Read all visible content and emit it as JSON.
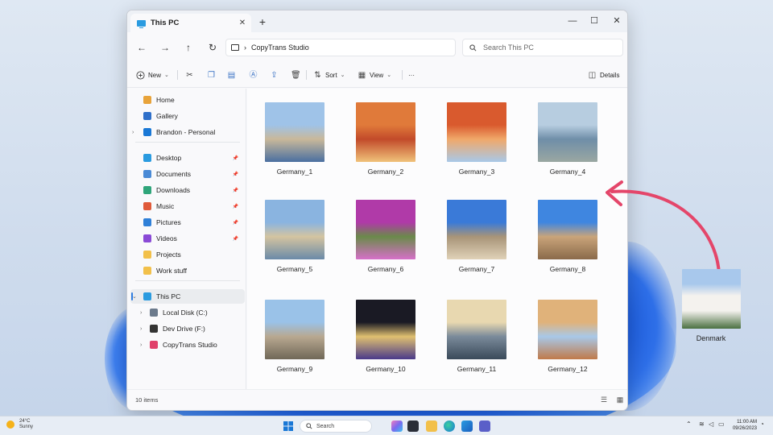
{
  "window": {
    "tab_title": "This PC",
    "new_tab": "+",
    "minimize": "—",
    "maximize": "☐",
    "close": "✕",
    "tab_close": "✕"
  },
  "address": {
    "crumb": "CopyTrans Studio",
    "separator": "›",
    "search_placeholder": "Search This PC"
  },
  "toolbar": {
    "new_label": "New",
    "sort_label": "Sort",
    "view_label": "View",
    "more_label": "···",
    "details_label": "Details"
  },
  "sidebar": {
    "top": [
      {
        "label": "Home",
        "icon": "home-icon",
        "color": "#e8a33a"
      },
      {
        "label": "Gallery",
        "icon": "gallery-icon",
        "color": "#2f6fc9"
      },
      {
        "label": "Brandon - Personal",
        "icon": "onedrive-icon",
        "color": "#1a78d6"
      }
    ],
    "pinned": [
      {
        "label": "Desktop",
        "icon": "desktop-icon",
        "color": "#2a9be0"
      },
      {
        "label": "Documents",
        "icon": "documents-icon",
        "color": "#4a8ad6"
      },
      {
        "label": "Downloads",
        "icon": "downloads-icon",
        "color": "#2fa57a"
      },
      {
        "label": "Music",
        "icon": "music-icon",
        "color": "#e05a3a"
      },
      {
        "label": "Pictures",
        "icon": "pictures-icon",
        "color": "#2f80d8"
      },
      {
        "label": "Videos",
        "icon": "videos-icon",
        "color": "#8a4ad6"
      },
      {
        "label": "Projects",
        "icon": "folder-icon",
        "color": "#f2c04a"
      },
      {
        "label": "Work stuff",
        "icon": "folder-icon",
        "color": "#f2c04a"
      }
    ],
    "pc": [
      {
        "label": "This PC",
        "icon": "this-pc-icon",
        "color": "#2a9be0"
      },
      {
        "label": "Local Disk (C:)",
        "icon": "disk-icon",
        "color": "#6b7a8c"
      },
      {
        "label": "Dev Drive (F:)",
        "icon": "drive-icon",
        "color": "#333333"
      },
      {
        "label": "CopyTrans Studio",
        "icon": "copytrans-icon",
        "color": "#e0406a"
      }
    ]
  },
  "files": [
    {
      "name": "Germany_1",
      "colors": [
        "#9fc3e8",
        "#c9b89a",
        "#4a6fa0"
      ]
    },
    {
      "name": "Germany_2",
      "colors": [
        "#e07a3a",
        "#c24a2a",
        "#f0c27a"
      ]
    },
    {
      "name": "Germany_3",
      "colors": [
        "#d95a2e",
        "#f0a86a",
        "#a8c8e8"
      ]
    },
    {
      "name": "Germany_4",
      "colors": [
        "#b7cde0",
        "#6f8ea8",
        "#9aa7a2"
      ]
    },
    {
      "name": "Germany_5",
      "colors": [
        "#8ab4e0",
        "#d4c4a0",
        "#6a8aa8"
      ]
    },
    {
      "name": "Germany_6",
      "colors": [
        "#b03aa8",
        "#6a8a4a",
        "#d670c8"
      ]
    },
    {
      "name": "Germany_7",
      "colors": [
        "#3a7ad8",
        "#a89478",
        "#e0d2b8"
      ]
    },
    {
      "name": "Germany_8",
      "colors": [
        "#3f86e0",
        "#c9a47a",
        "#8a6a4a"
      ]
    },
    {
      "name": "Germany_9",
      "colors": [
        "#9ac2e8",
        "#b8a890",
        "#706858"
      ]
    },
    {
      "name": "Germany_10",
      "colors": [
        "#1a1a24",
        "#e0c070",
        "#4a3a8a"
      ]
    },
    {
      "name": "Germany_11",
      "colors": [
        "#e8d8b0",
        "#7a8a9a",
        "#3a4a5a"
      ]
    },
    {
      "name": "Germany_12",
      "colors": [
        "#e0b27a",
        "#a8c8e8",
        "#c07a4a"
      ]
    }
  ],
  "status": {
    "item_count": "10 items"
  },
  "floating": {
    "label": "Denmark",
    "colors": [
      "#a8c8ec",
      "#f4f2ee",
      "#4a7040"
    ]
  },
  "taskbar": {
    "temperature": "24°C",
    "condition": "Sunny",
    "search_label": "Search",
    "time": "11:00 AM",
    "date": "09/26/2023"
  },
  "accent": {
    "arrow": "#e4466a",
    "blue": "#2f7de0"
  }
}
